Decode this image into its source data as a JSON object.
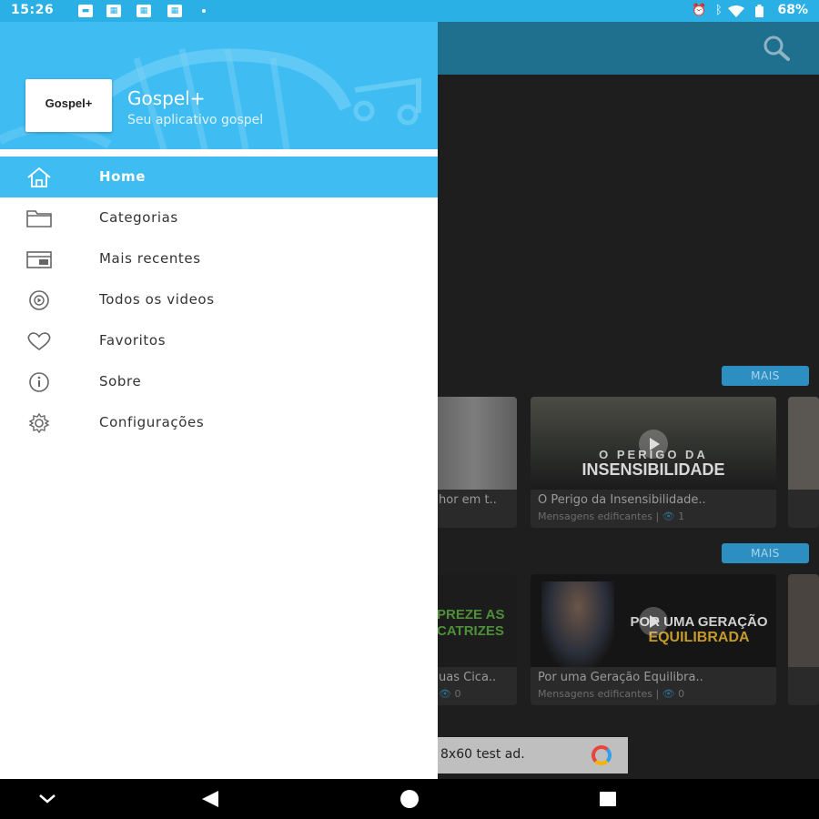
{
  "status_bar": {
    "time": "15:26",
    "battery": "68%",
    "icons": [
      "alarm-icon",
      "bluetooth-icon",
      "wifi-icon",
      "battery-icon"
    ]
  },
  "drawer": {
    "logo_text": "Gospel+",
    "title": "Gospel+",
    "subtitle": "Seu aplicativo gospel",
    "items": [
      {
        "label": "Home",
        "icon": "home-icon",
        "active": true
      },
      {
        "label": "Categorias",
        "icon": "folder-icon",
        "active": false
      },
      {
        "label": "Mais recentes",
        "icon": "recent-icon",
        "active": false
      },
      {
        "label": "Todos os videos",
        "icon": "video-icon",
        "active": false
      },
      {
        "label": "Favoritos",
        "icon": "heart-icon",
        "active": false
      },
      {
        "label": "Sobre",
        "icon": "info-icon",
        "active": false
      },
      {
        "label": "Configurações",
        "icon": "gear-icon",
        "active": false
      }
    ]
  },
  "background": {
    "mais_label": "MAIS",
    "row1": {
      "partial_title": "hor em t..",
      "video": {
        "title": "O Perigo da Insensibilidade..",
        "meta": "Mensagens edificantes |",
        "views": "1",
        "caption_top": "O PERIGO DA",
        "caption_bottom": "INSENSIBILIDADE"
      }
    },
    "row2": {
      "partial_title": "uas Cica..",
      "partial_views": "0",
      "partial_caption_top": "PREZE AS",
      "partial_caption_bottom": "CATRIZES",
      "video": {
        "title": "Por uma Geração Equilibra..",
        "meta": "Mensagens edificantes |",
        "views": "0",
        "caption_top": "POR UMA GERAÇÃO",
        "caption_bottom": "EQUILIBRADA"
      }
    },
    "ad_text": "8x60 test ad."
  },
  "colors": {
    "accent": "#3fbdf2",
    "status_bar": "#2bb0e6",
    "toolbar": "#1f6f8f",
    "mais_button": "#2d8fc1"
  }
}
